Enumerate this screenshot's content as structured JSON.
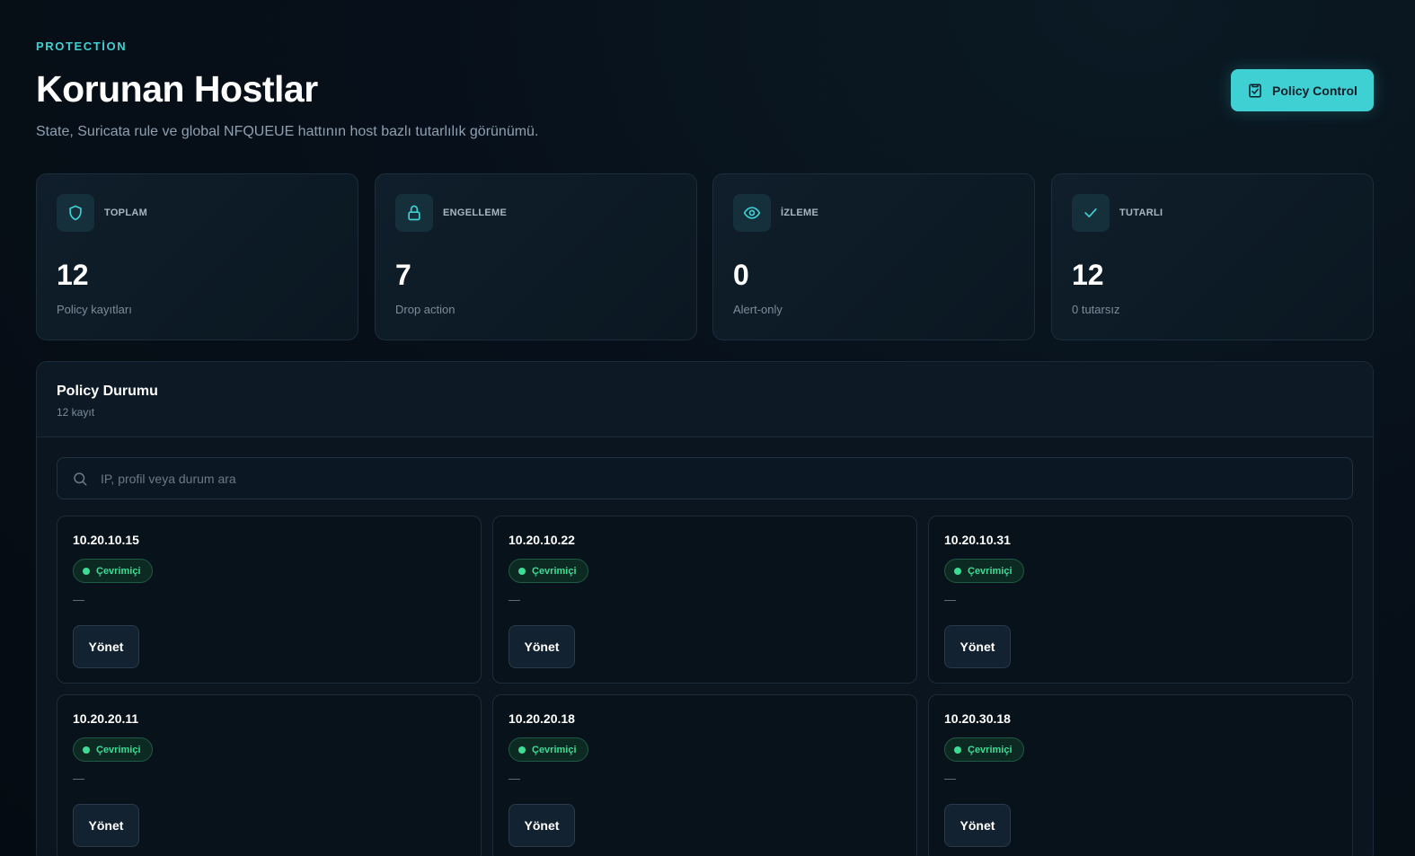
{
  "header": {
    "eyebrow": "PROTECTİON",
    "title": "Korunan Hostlar",
    "subtitle": "State, Suricata rule ve global NFQUEUE hattının host bazlı tutarlılık görünümü.",
    "policy_button": "Policy Control",
    "policy_icon": "clipboard-check-icon"
  },
  "stats": [
    {
      "icon": "shield-icon",
      "label": "TOPLAM",
      "value": "12",
      "sub": "Policy kayıtları"
    },
    {
      "icon": "lock-icon",
      "label": "ENGELLEME",
      "value": "7",
      "sub": "Drop action"
    },
    {
      "icon": "eye-icon",
      "label": "İZLEME",
      "value": "0",
      "sub": "Alert-only"
    },
    {
      "icon": "check-icon",
      "label": "TUTARLI",
      "value": "12",
      "sub": "0 tutarsız"
    }
  ],
  "panel": {
    "title": "Policy Durumu",
    "count": "12 kayıt",
    "search_placeholder": "IP, profil veya durum ara"
  },
  "hosts": [
    {
      "ip": "10.20.10.15",
      "status": "Çevrimiçi",
      "detail": "—",
      "action": "Yönet"
    },
    {
      "ip": "10.20.10.22",
      "status": "Çevrimiçi",
      "detail": "—",
      "action": "Yönet"
    },
    {
      "ip": "10.20.10.31",
      "status": "Çevrimiçi",
      "detail": "—",
      "action": "Yönet"
    },
    {
      "ip": "10.20.20.11",
      "status": "Çevrimiçi",
      "detail": "—",
      "action": "Yönet"
    },
    {
      "ip": "10.20.20.18",
      "status": "Çevrimiçi",
      "detail": "—",
      "action": "Yönet"
    },
    {
      "ip": "10.20.30.18",
      "status": "Çevrimiçi",
      "detail": "—",
      "action": "Yönet"
    }
  ],
  "colors": {
    "accent": "#3fd0d4",
    "online": "#3ddc97",
    "background": "#050b12"
  }
}
